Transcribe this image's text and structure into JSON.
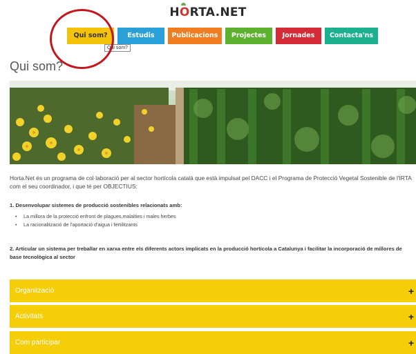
{
  "header": {
    "logo_pre": "H",
    "logo_o": "O",
    "logo_post": "RTA.NET"
  },
  "nav": {
    "items": [
      {
        "label": "Qui som?"
      },
      {
        "label": "Estudis"
      },
      {
        "label": "Publicacions"
      },
      {
        "label": "Projectes"
      },
      {
        "label": "Jornades"
      },
      {
        "label": "Contacta'ns"
      }
    ],
    "tooltip": "Qui som?"
  },
  "main": {
    "title": "Qui som?",
    "intro": "Horta.Net és un programa de col·laboració per al sector hortícola català que està impulsat pel DACC i el Programa de Protecció Vegetal Sostenible de l'IRTA com el seu coordinador, i que té per OBJECTIUS:",
    "point1": "1. Desenvolupar sistemes de producció sostenibles relacionats amb:",
    "bullets": [
      "La millora de la protecció enfront de plagues,malalties i males herbes",
      "La racionalització de l'aportació d'aigua i fertilitzants"
    ],
    "point2": "2. Articular un sistema per treballar en xarxa entre els diferents actors implicats en la producció hortícola a Catalunya i facilitar la incorporació de millores de base tecnològica al sector"
  },
  "accordion": [
    {
      "label": "Organització",
      "icon": "+"
    },
    {
      "label": "Activitats",
      "icon": "+"
    },
    {
      "label": "Com participar",
      "icon": "+"
    }
  ],
  "colors": {
    "accordion": "#f5cd09",
    "nav_qui_som": "#f5c20a",
    "nav_estudis": "#2aa0d8",
    "nav_publicacions": "#f07d22",
    "nav_projectes": "#5db12f",
    "nav_jornades": "#d42a35",
    "nav_contacta": "#1bb08e",
    "annotation": "#c0171e"
  }
}
